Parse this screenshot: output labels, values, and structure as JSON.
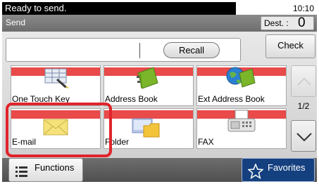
{
  "status": {
    "message": "Ready to send.",
    "time": "10:10"
  },
  "title": {
    "label": "Send"
  },
  "destination": {
    "label": "Dest. :",
    "count": "0"
  },
  "buttons": {
    "recall": "Recall",
    "check": "Check",
    "functions": "Functions",
    "favorites": "Favorites"
  },
  "tiles": [
    {
      "label": "One Touch Key",
      "icon": "one-touch-key-icon"
    },
    {
      "label": "Address Book",
      "icon": "address-book-icon"
    },
    {
      "label": "Ext Address Book",
      "icon": "ext-address-book-icon"
    },
    {
      "label": "E-mail",
      "icon": "envelope-icon"
    },
    {
      "label": "Folder",
      "icon": "folder-icon"
    },
    {
      "label": "FAX",
      "icon": "fax-icon"
    }
  ],
  "pagination": {
    "indicator": "1/2"
  },
  "colors": {
    "tile_stripe": "#e94a4a",
    "highlight": "#e0242b",
    "favorites_bg": "#15407f"
  }
}
